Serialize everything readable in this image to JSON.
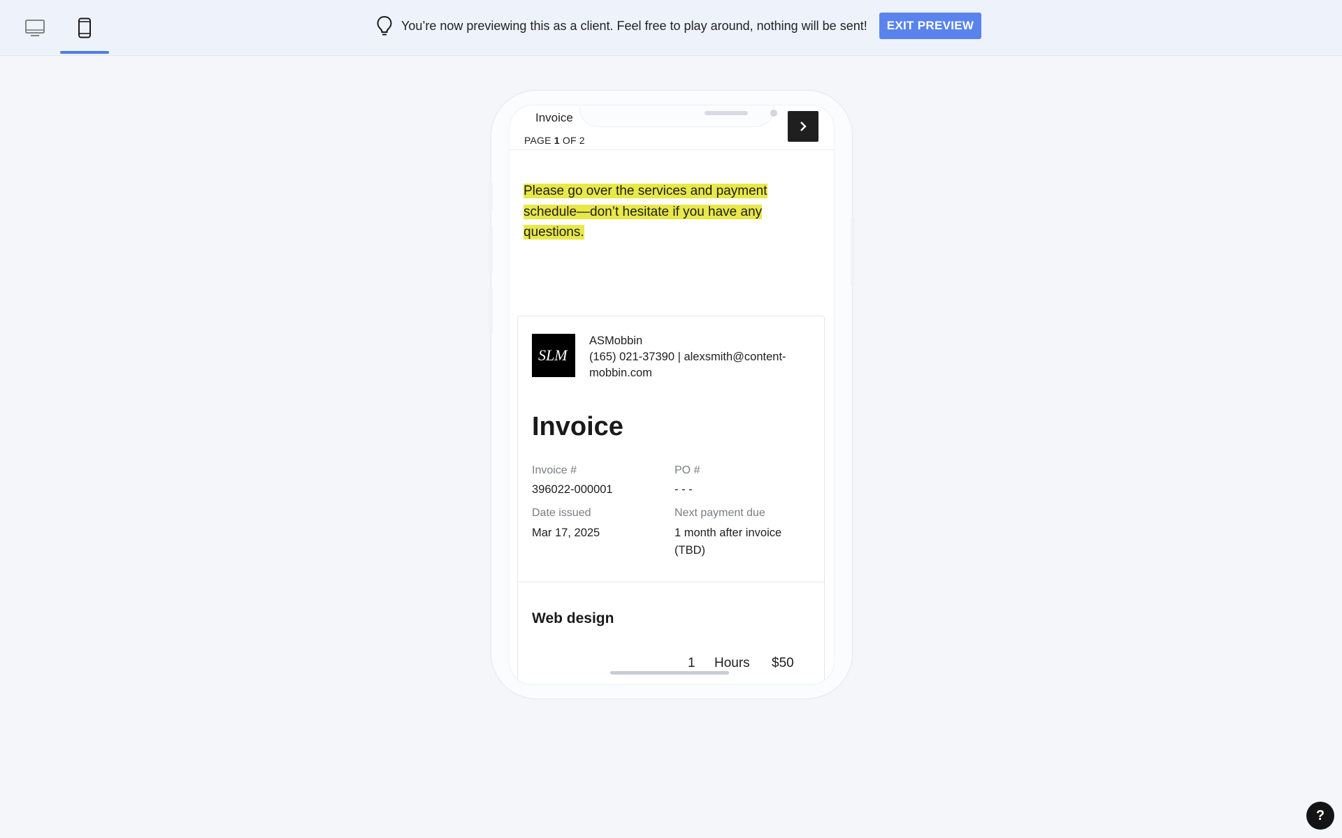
{
  "topbar": {
    "banner_text": "You’re now previewing this as a client. Feel free to play around, nothing will be sent!",
    "exit_label": "EXIT PREVIEW",
    "active_view": "mobile",
    "icons": {
      "desktop": "monitor-icon",
      "mobile": "phone-icon",
      "banner": "lightbulb-icon"
    },
    "accent_color": "#4f7de8"
  },
  "screen": {
    "doc_select": "Invoice",
    "page_prefix": "PAGE ",
    "page_current": "1",
    "page_suffix": " OF 2",
    "message": "Please go over the services and payment schedule—don’t hesitate if you have any questions.",
    "highlight_color": "#e8e84a"
  },
  "invoice": {
    "logo_text": "SLM",
    "company_name": "ASMobbin",
    "company_contact": "(165) 021-37390 | alexsmith@content-mobbin.com",
    "title": "Invoice",
    "invoice_no_label": "Invoice #",
    "invoice_no": "396022-000001",
    "po_label": "PO #",
    "po_value": "- - -",
    "date_label": "Date issued",
    "date_value": "Mar 17, 2025",
    "due_label": "Next payment due",
    "due_value": "1 month after invoice (TBD)",
    "section": "Web design",
    "qty": "1",
    "unit": "Hours",
    "price": "$50"
  },
  "help_label": "?"
}
